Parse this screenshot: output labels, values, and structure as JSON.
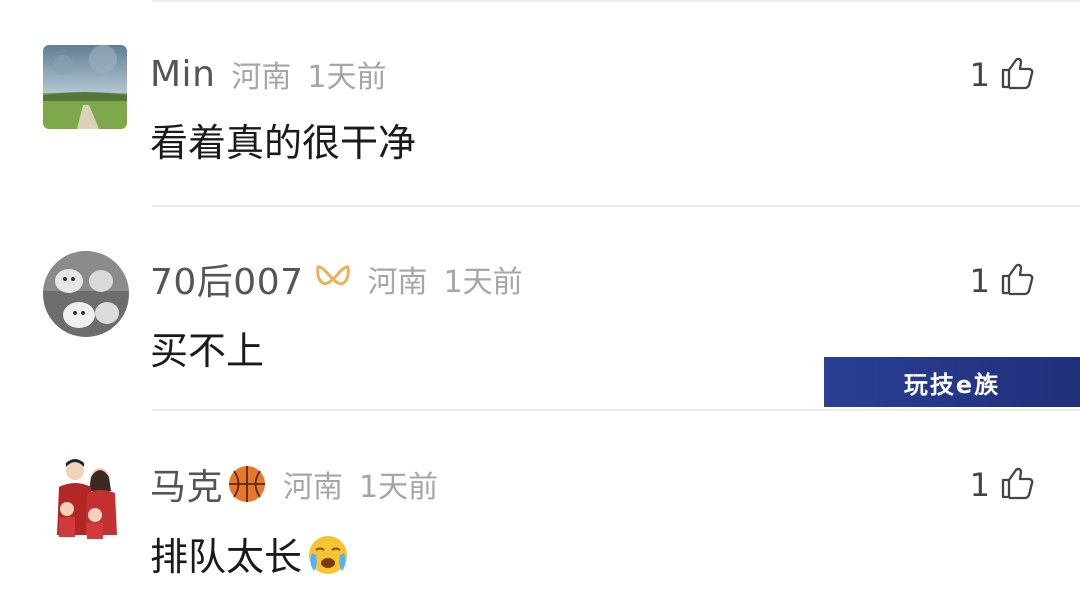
{
  "comments": [
    {
      "username": "Min",
      "location": "河南",
      "time": "1天前",
      "text": "看着真的很干净",
      "likes": "1",
      "avatar": "landscape-avatar"
    },
    {
      "username": "70后007",
      "location": "河南",
      "time": "1天前",
      "text": "买不上",
      "likes": "1",
      "badge": "vip-ribbon-icon",
      "avatar": "cats-avatar"
    },
    {
      "username": "马克",
      "location": "河南",
      "time": "1天前",
      "text": "排队太长",
      "likes": "1",
      "name_emoji": "basketball-icon",
      "text_emoji": "crying-face-icon",
      "avatar": "family-avatar"
    }
  ],
  "watermark": {
    "text": "玩技e族"
  },
  "colors": {
    "username": "#555555",
    "meta": "#a6a6a6",
    "text": "#1a1a1a",
    "watermark_bg": "#2a3f95"
  }
}
